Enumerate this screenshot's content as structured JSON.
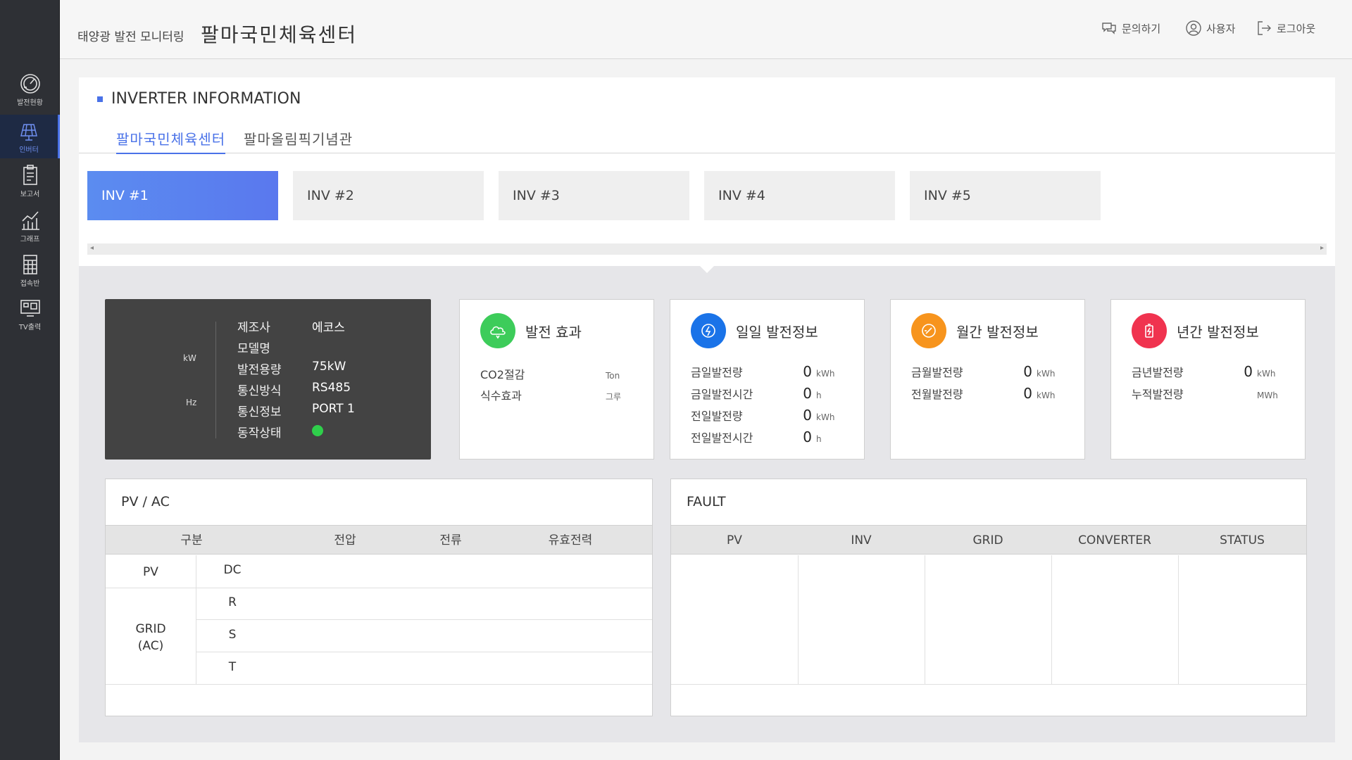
{
  "sidebar": {
    "items": [
      {
        "label": "발전현황",
        "icon": "gauge-icon"
      },
      {
        "label": "인버터",
        "icon": "solar-panel-icon"
      },
      {
        "label": "보고서",
        "icon": "clipboard-icon"
      },
      {
        "label": "그래프",
        "icon": "chart-icon"
      },
      {
        "label": "접속반",
        "icon": "grid-box-icon"
      },
      {
        "label": "TV출력",
        "icon": "tv-icon"
      }
    ],
    "active_index": 1
  },
  "header": {
    "app_title": "태양광 발전 모니터링",
    "site_title": "팔마국민체육센터",
    "inquiry_label": "문의하기",
    "user_label": "사용자",
    "logout_label": "로그아웃"
  },
  "section": {
    "title": "INVERTER INFORMATION",
    "site_tabs": [
      "팔마국민체육센터",
      "팔마올림픽기념관"
    ],
    "active_site": 0,
    "inverters": [
      "INV #1",
      "INV #2",
      "INV #3",
      "INV #4",
      "INV #5"
    ],
    "active_inverter": 0
  },
  "inverter_info": {
    "unit_kw": "kW",
    "unit_hz": "Hz",
    "rows": [
      {
        "key": "제조사",
        "value": "에코스"
      },
      {
        "key": "모델명",
        "value": ""
      },
      {
        "key": "발전용량",
        "value": "75kW"
      },
      {
        "key": "통신방식",
        "value": "RS485"
      },
      {
        "key": "통신정보",
        "value": "PORT 1"
      },
      {
        "key": "동작상태",
        "value": ""
      }
    ],
    "status_color": "#2fcf4b"
  },
  "cards": {
    "effect": {
      "title": "발전 효과",
      "color": "#3dcc5a",
      "rows": [
        {
          "label": "CO2절감",
          "value": "",
          "unit": "Ton"
        },
        {
          "label": "식수효과",
          "value": "",
          "unit": "그루"
        }
      ]
    },
    "daily": {
      "title": "일일 발전정보",
      "color": "#1a73e8",
      "rows": [
        {
          "label": "금일발전량",
          "value": "0",
          "unit": "kWh"
        },
        {
          "label": "금일발전시간",
          "value": "0",
          "unit": "h"
        },
        {
          "label": "전일발전량",
          "value": "0",
          "unit": "kWh"
        },
        {
          "label": "전일발전시간",
          "value": "0",
          "unit": "h"
        }
      ]
    },
    "monthly": {
      "title": "월간 발전정보",
      "color": "#f7941d",
      "rows": [
        {
          "label": "금월발전량",
          "value": "0",
          "unit": "kWh"
        },
        {
          "label": "전월발전량",
          "value": "0",
          "unit": "kWh"
        }
      ]
    },
    "yearly": {
      "title": "년간 발전정보",
      "color": "#f0334f",
      "rows": [
        {
          "label": "금년발전량",
          "value": "0",
          "unit": "kWh"
        },
        {
          "label": "누적발전량",
          "value": "",
          "unit": "MWh"
        }
      ]
    }
  },
  "pvac": {
    "title": "PV / AC",
    "headers": [
      "구분",
      "전압",
      "전류",
      "유효전력"
    ],
    "group_pv": "PV",
    "group_grid": "GRID\n(AC)",
    "rows": [
      "DC",
      "R",
      "S",
      "T"
    ]
  },
  "fault": {
    "title": "FAULT",
    "headers": [
      "PV",
      "INV",
      "GRID",
      "CONVERTER",
      "STATUS"
    ]
  }
}
